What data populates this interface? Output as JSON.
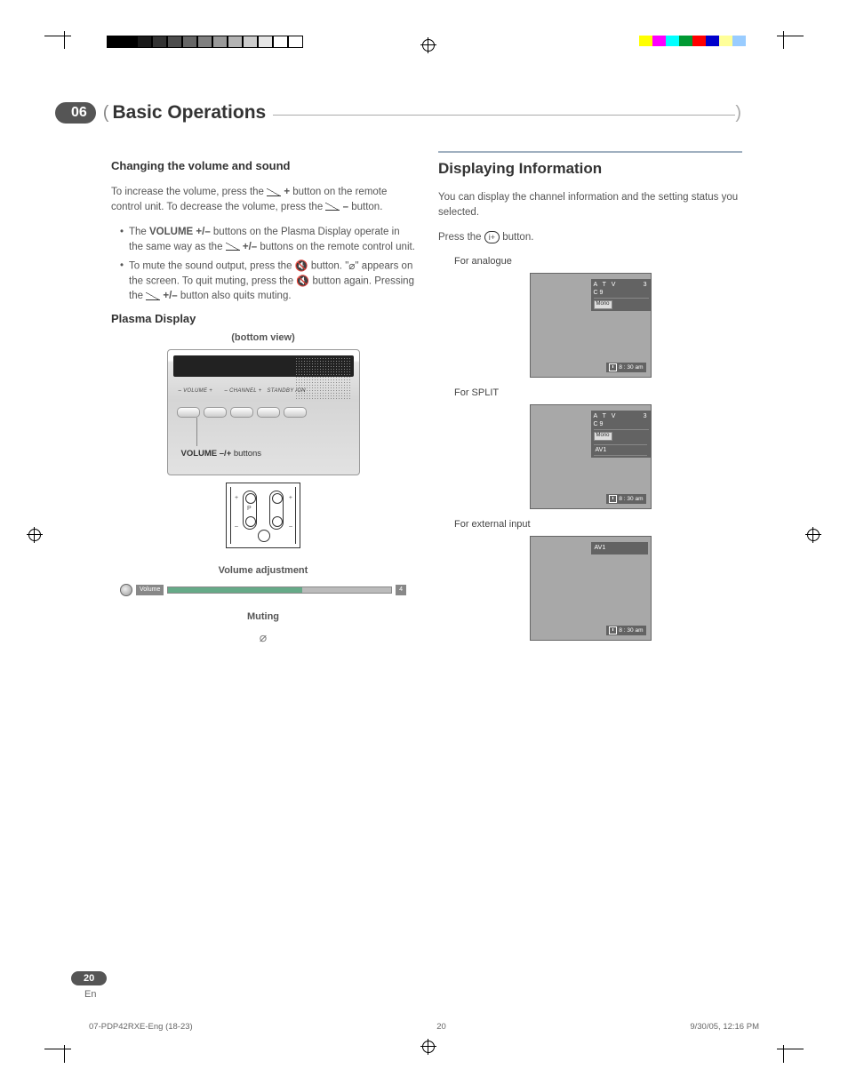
{
  "chapter": {
    "number": "06",
    "title": "Basic Operations"
  },
  "left_col": {
    "h_volume": "Changing the volume and sound",
    "vol_intro_a": "To increase the volume, press the ",
    "vol_intro_plus": " + ",
    "vol_intro_b": "button on the remote control unit. To decrease the volume, press the ",
    "vol_intro_minus": " – ",
    "vol_intro_c": "button.",
    "bullet1_a": "The ",
    "bullet1_bold": "VOLUME +/–",
    "bullet1_b": " buttons on the Plasma Display operate in the same way as the ",
    "bullet1_pm": " +/– ",
    "bullet1_c": "buttons on the remote control unit.",
    "bullet2_a": "To mute the sound output, press the ",
    "bullet2_b": " button. \"",
    "bullet2_c": "\" appears on the screen. To quit muting, press the ",
    "bullet2_d": " button again. Pressing the ",
    "bullet2_pm": " +/– ",
    "bullet2_e": "button also quits muting.",
    "h_plasma": "Plasma Display",
    "bottom_view": "(bottom view)",
    "device_labels": {
      "vol": "–  VOLUME  +",
      "ch": "–  CHANNEL  +",
      "standby": "STANDBY /ON"
    },
    "device_callout_bold": "VOLUME –/+",
    "device_callout_rest": " buttons",
    "remote_labels": {
      "plus_l": "+",
      "minus_l": "–",
      "p": "P",
      "plus_r": "+",
      "minus_r": "–"
    },
    "h_voladj": "Volume adjustment",
    "volbar": {
      "label": "Volume",
      "value": "4"
    },
    "h_muting": "Muting"
  },
  "right_col": {
    "section_title": "Displaying Information",
    "intro": "You can display the channel information and the setting status you selected.",
    "press_a": "Press the ",
    "press_b": " button.",
    "scenario1": "For analogue",
    "scenario2": "For SPLIT",
    "scenario3": "For external input",
    "osd": {
      "atv": "A T V",
      "num": "3",
      "ch": "C 9",
      "mono": "Mono",
      "av1": "AV1",
      "time": "8 : 30 am"
    }
  },
  "page": {
    "number": "20",
    "lang": "En"
  },
  "footer": {
    "file": "07-PDP42RXE-Eng (18-23)",
    "page": "20",
    "stamp": "9/30/05, 12:16 PM"
  },
  "swatches_left": [
    "#000",
    "#000",
    "#1a1a1a",
    "#333",
    "#4d4d4d",
    "#666",
    "#808080",
    "#999",
    "#b3b3b3",
    "#ccc",
    "#e6e6e6",
    "#fff",
    "#fff"
  ],
  "swatches_right": [
    "#ffff00",
    "#ff00ff",
    "#00ffff",
    "#009933",
    "#ff0000",
    "#0000cc",
    "#ffff99",
    "#99ccff",
    "#fff"
  ]
}
